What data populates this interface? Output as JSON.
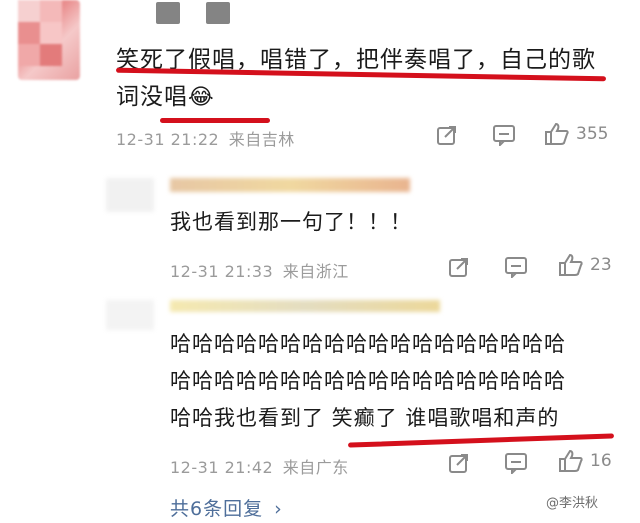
{
  "comment": {
    "text_line1": "笑死了假唱，唱错了，把伴奏唱了，自己的歌",
    "text_line2": "词没唱",
    "emoji": "😂",
    "time": "12-31 21:22",
    "location": "来自吉林",
    "likes": "355"
  },
  "replies": [
    {
      "text": "我也看到那一句了！！！",
      "time": "12-31 21:33",
      "location": "来自浙江",
      "likes": "23"
    },
    {
      "text_line1": "哈哈哈哈哈哈哈哈哈哈哈哈哈哈哈哈哈哈",
      "text_line2": "哈哈哈哈哈哈哈哈哈哈哈哈哈哈哈哈哈哈",
      "text_line3": "哈哈我也看到了 笑癫了 谁唱歌唱和声的",
      "time": "12-31 21:42",
      "location": "来自广东",
      "likes": "16"
    }
  ],
  "more_replies": "共6条回复",
  "more_replies_arrow": "›",
  "watermark": "@李洪秋",
  "icons": [
    "share-icon",
    "comment-icon",
    "like-icon"
  ],
  "colors": {
    "annotation_red": "#d4101c",
    "link_blue": "#4e6e9a",
    "meta_gray": "#9b9b9b"
  }
}
